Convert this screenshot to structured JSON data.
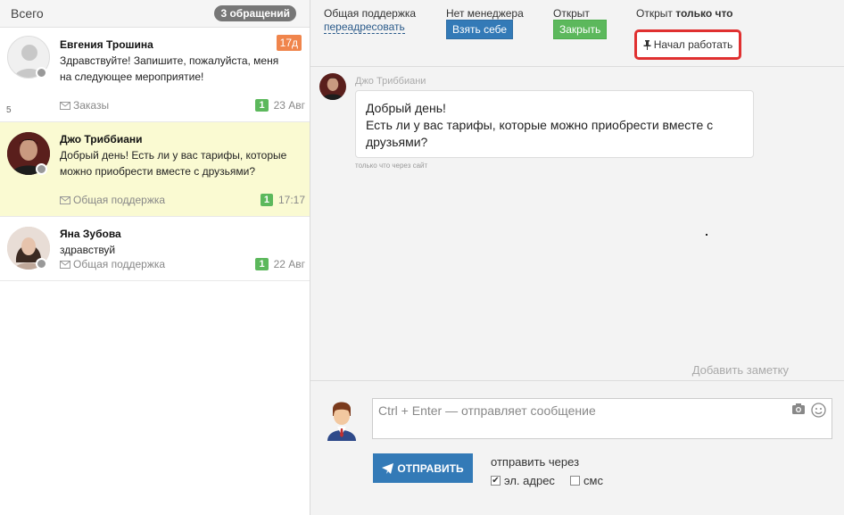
{
  "left": {
    "title": "Всего",
    "badge": "3 обращений",
    "conversations": [
      {
        "name": "Евгения Трошина",
        "message": "Здравствуйте! Запишите, пожалуйста, меня на следующее мероприятие!",
        "department": "Заказы",
        "count": "1",
        "time": "23 Авг",
        "tag": "17д",
        "number": "5"
      },
      {
        "name": "Джо Триббиани",
        "message": "Добрый день! Есть ли у вас тарифы, которые можно приобрести вместе с друзьями?",
        "department": "Общая поддержка",
        "count": "1",
        "time": "17:17"
      },
      {
        "name": "Яна Зубова",
        "message": "здравствуй",
        "department": "Общая поддержка",
        "count": "1",
        "time": "22 Авг"
      }
    ]
  },
  "topbar": {
    "department_label": "Общая поддержка",
    "redirect_link": "переадресовать",
    "manager_label": "Нет менеджера",
    "take_button": "Взять себе",
    "status_label": "Открыт",
    "close_button": "Закрыть",
    "open_prefix": "Открыт",
    "open_suffix": "только что",
    "status_tag": "Начал работать"
  },
  "chat": {
    "author": "Джо Триббиани",
    "line1": "Добрый день!",
    "line2": "Есть ли у вас тарифы, которые можно приобрести вместе с друзьями?",
    "time": "только что через сайт",
    "add_note": "Добавить заметку"
  },
  "compose": {
    "placeholder": "Ctrl + Enter — отправляет сообщение",
    "send_button": "ОТПРАВИТЬ",
    "send_via": "отправить через",
    "email_label": "эл. адрес",
    "sms_label": "смс"
  },
  "colors": {
    "accent_blue": "#337ab7",
    "green": "#5cb85c",
    "active_row": "#fafad2",
    "highlight_red": "#e03030",
    "tag_orange": "#f0854c"
  }
}
